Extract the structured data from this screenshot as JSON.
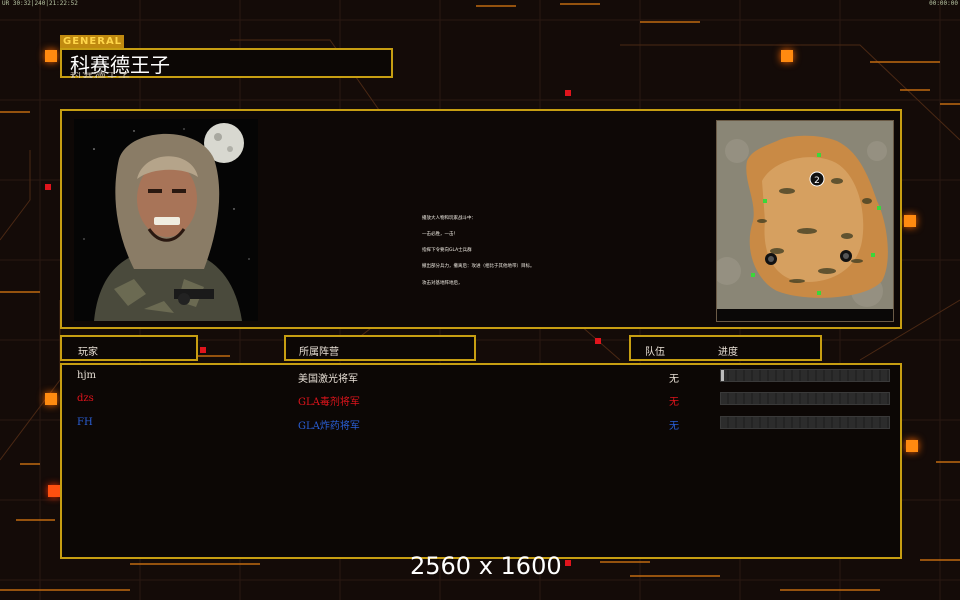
{
  "top_bar": {
    "left_status": "UR 30:32|240|21:22:52",
    "right_status": "00:00:00"
  },
  "header": {
    "rank_tag": "GENERAL",
    "general_name": "科赛德王子",
    "name_shadow": "科赛德王子"
  },
  "mission": {
    "portrait_icon": "general-portrait",
    "briefing_lines": [
      "播放大人物和玩家战斗中：",
      "一击必胜，一击！",
      "指挥下令要向GLA士兵群",
      "撤出部分兵力，撤离后：攻进（相比于其他地带）目标。",
      "攻击对基地阵地后，"
    ],
    "minimap_icon": "minimap",
    "minimap_marker": "2"
  },
  "columns": {
    "player": "玩家",
    "faction": "所属阵营",
    "team": "队伍",
    "progress": "进度"
  },
  "players": [
    {
      "name": "hjm",
      "faction": "美国激光将军",
      "team": "无",
      "color": "#e8e0d6",
      "progress": 0.02
    },
    {
      "name": "dzs",
      "faction": "GLA毒剂将军",
      "team": "无",
      "color": "#e0141c",
      "progress": 0
    },
    {
      "name": "FH",
      "faction": "GLA炸药将军",
      "team": "无",
      "color": "#2a5fd6",
      "progress": 0
    }
  ],
  "footer": {
    "resolution": "2560 x 1600"
  },
  "colors": {
    "frame": "#c79e12",
    "accent_orange": "#ff8a10",
    "background": "#140b08"
  }
}
